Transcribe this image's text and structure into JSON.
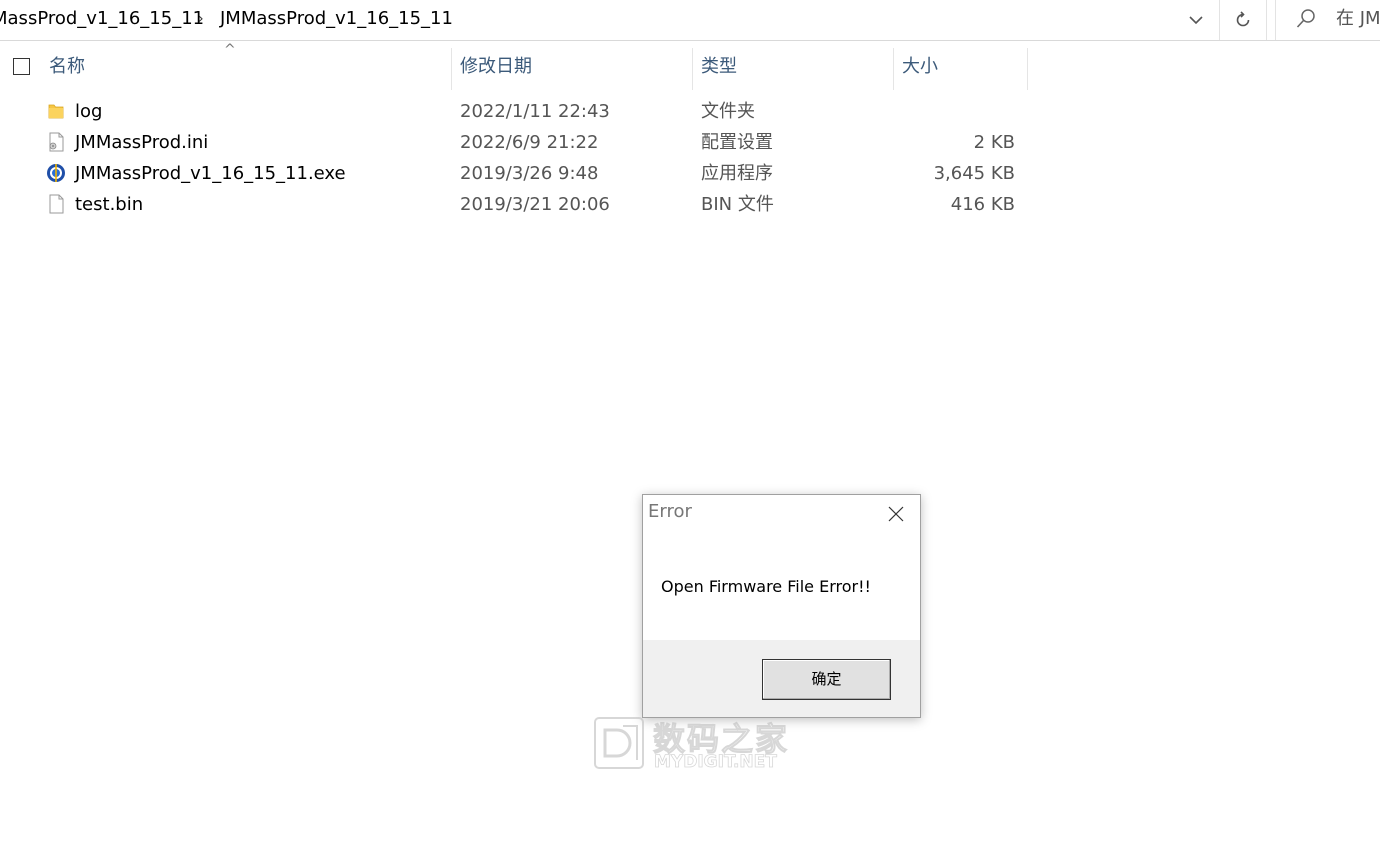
{
  "address_bar": {
    "crumbs": [
      "MassProd_v1_16_15_11",
      "JMMassProd_v1_16_15_11"
    ],
    "separator": "›",
    "search_placeholder": "在 JM"
  },
  "columns": {
    "name": "名称",
    "date": "修改日期",
    "type": "类型",
    "size": "大小"
  },
  "files": [
    {
      "name": "log",
      "date": "2022/1/11 22:43",
      "type": "文件夹",
      "size": "",
      "icon": "folder-icon"
    },
    {
      "name": "JMMassProd.ini",
      "date": "2022/6/9 21:22",
      "type": "配置设置",
      "size": "2 KB",
      "icon": "settings-file-icon"
    },
    {
      "name": "JMMassProd_v1_16_15_11.exe",
      "date": "2019/3/26 9:48",
      "type": "应用程序",
      "size": "3,645 KB",
      "icon": "exe-app-icon"
    },
    {
      "name": "test.bin",
      "date": "2019/3/21 20:06",
      "type": "BIN 文件",
      "size": "416 KB",
      "icon": "blank-file-icon"
    }
  ],
  "dialog": {
    "title": "Error",
    "message": "Open Firmware File Error!!",
    "ok_label": "确定"
  },
  "watermark": {
    "cn": "数码之家",
    "en": "MYDIGIT.NET"
  },
  "colors": {
    "header_text": "#3c5a7a",
    "secondary_text": "#555555",
    "dialog_footer": "#f0f0f0",
    "folder": "#f6c644"
  }
}
